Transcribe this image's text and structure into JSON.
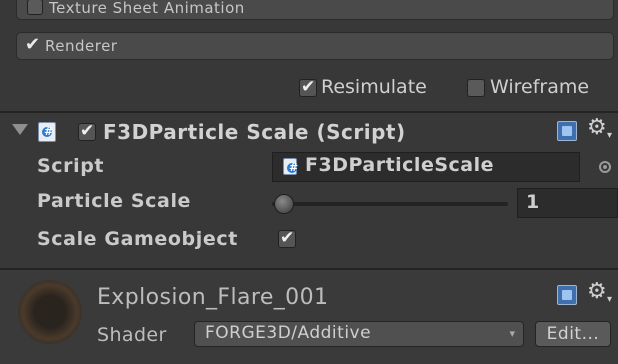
{
  "modules": [
    {
      "label": "Texture Sheet Animation",
      "enabled": false
    },
    {
      "label": "Renderer",
      "enabled": true
    }
  ],
  "toolbar": {
    "resimulate_label": "Resimulate",
    "resimulate_checked": true,
    "wireframe_label": "Wireframe",
    "wireframe_checked": false
  },
  "component": {
    "title": "F3DParticle Scale (Script)",
    "enabled": true,
    "properties": {
      "script_label": "Script",
      "script_value": "F3DParticleScale",
      "particle_scale_label": "Particle Scale",
      "particle_scale_value": "1",
      "particle_scale_slider_fraction": 0.05,
      "scale_gameobject_label": "Scale Gameobject",
      "scale_gameobject_checked": true
    }
  },
  "material": {
    "name": "Explosion_Flare_001",
    "shader_label": "Shader",
    "shader_value": "FORGE3D/Additive",
    "edit_label": "Edit..."
  },
  "icons": {
    "script": "csharp-script-icon",
    "help": "help-book-icon",
    "settings": "gear-icon",
    "object_picker": "object-picker-icon",
    "fold": "foldout-arrow-icon"
  },
  "colors": {
    "background": "#383838",
    "field": "#2c2c2c",
    "text": "#c4c4c4",
    "script_icon_accent": "#2d7bd1"
  }
}
